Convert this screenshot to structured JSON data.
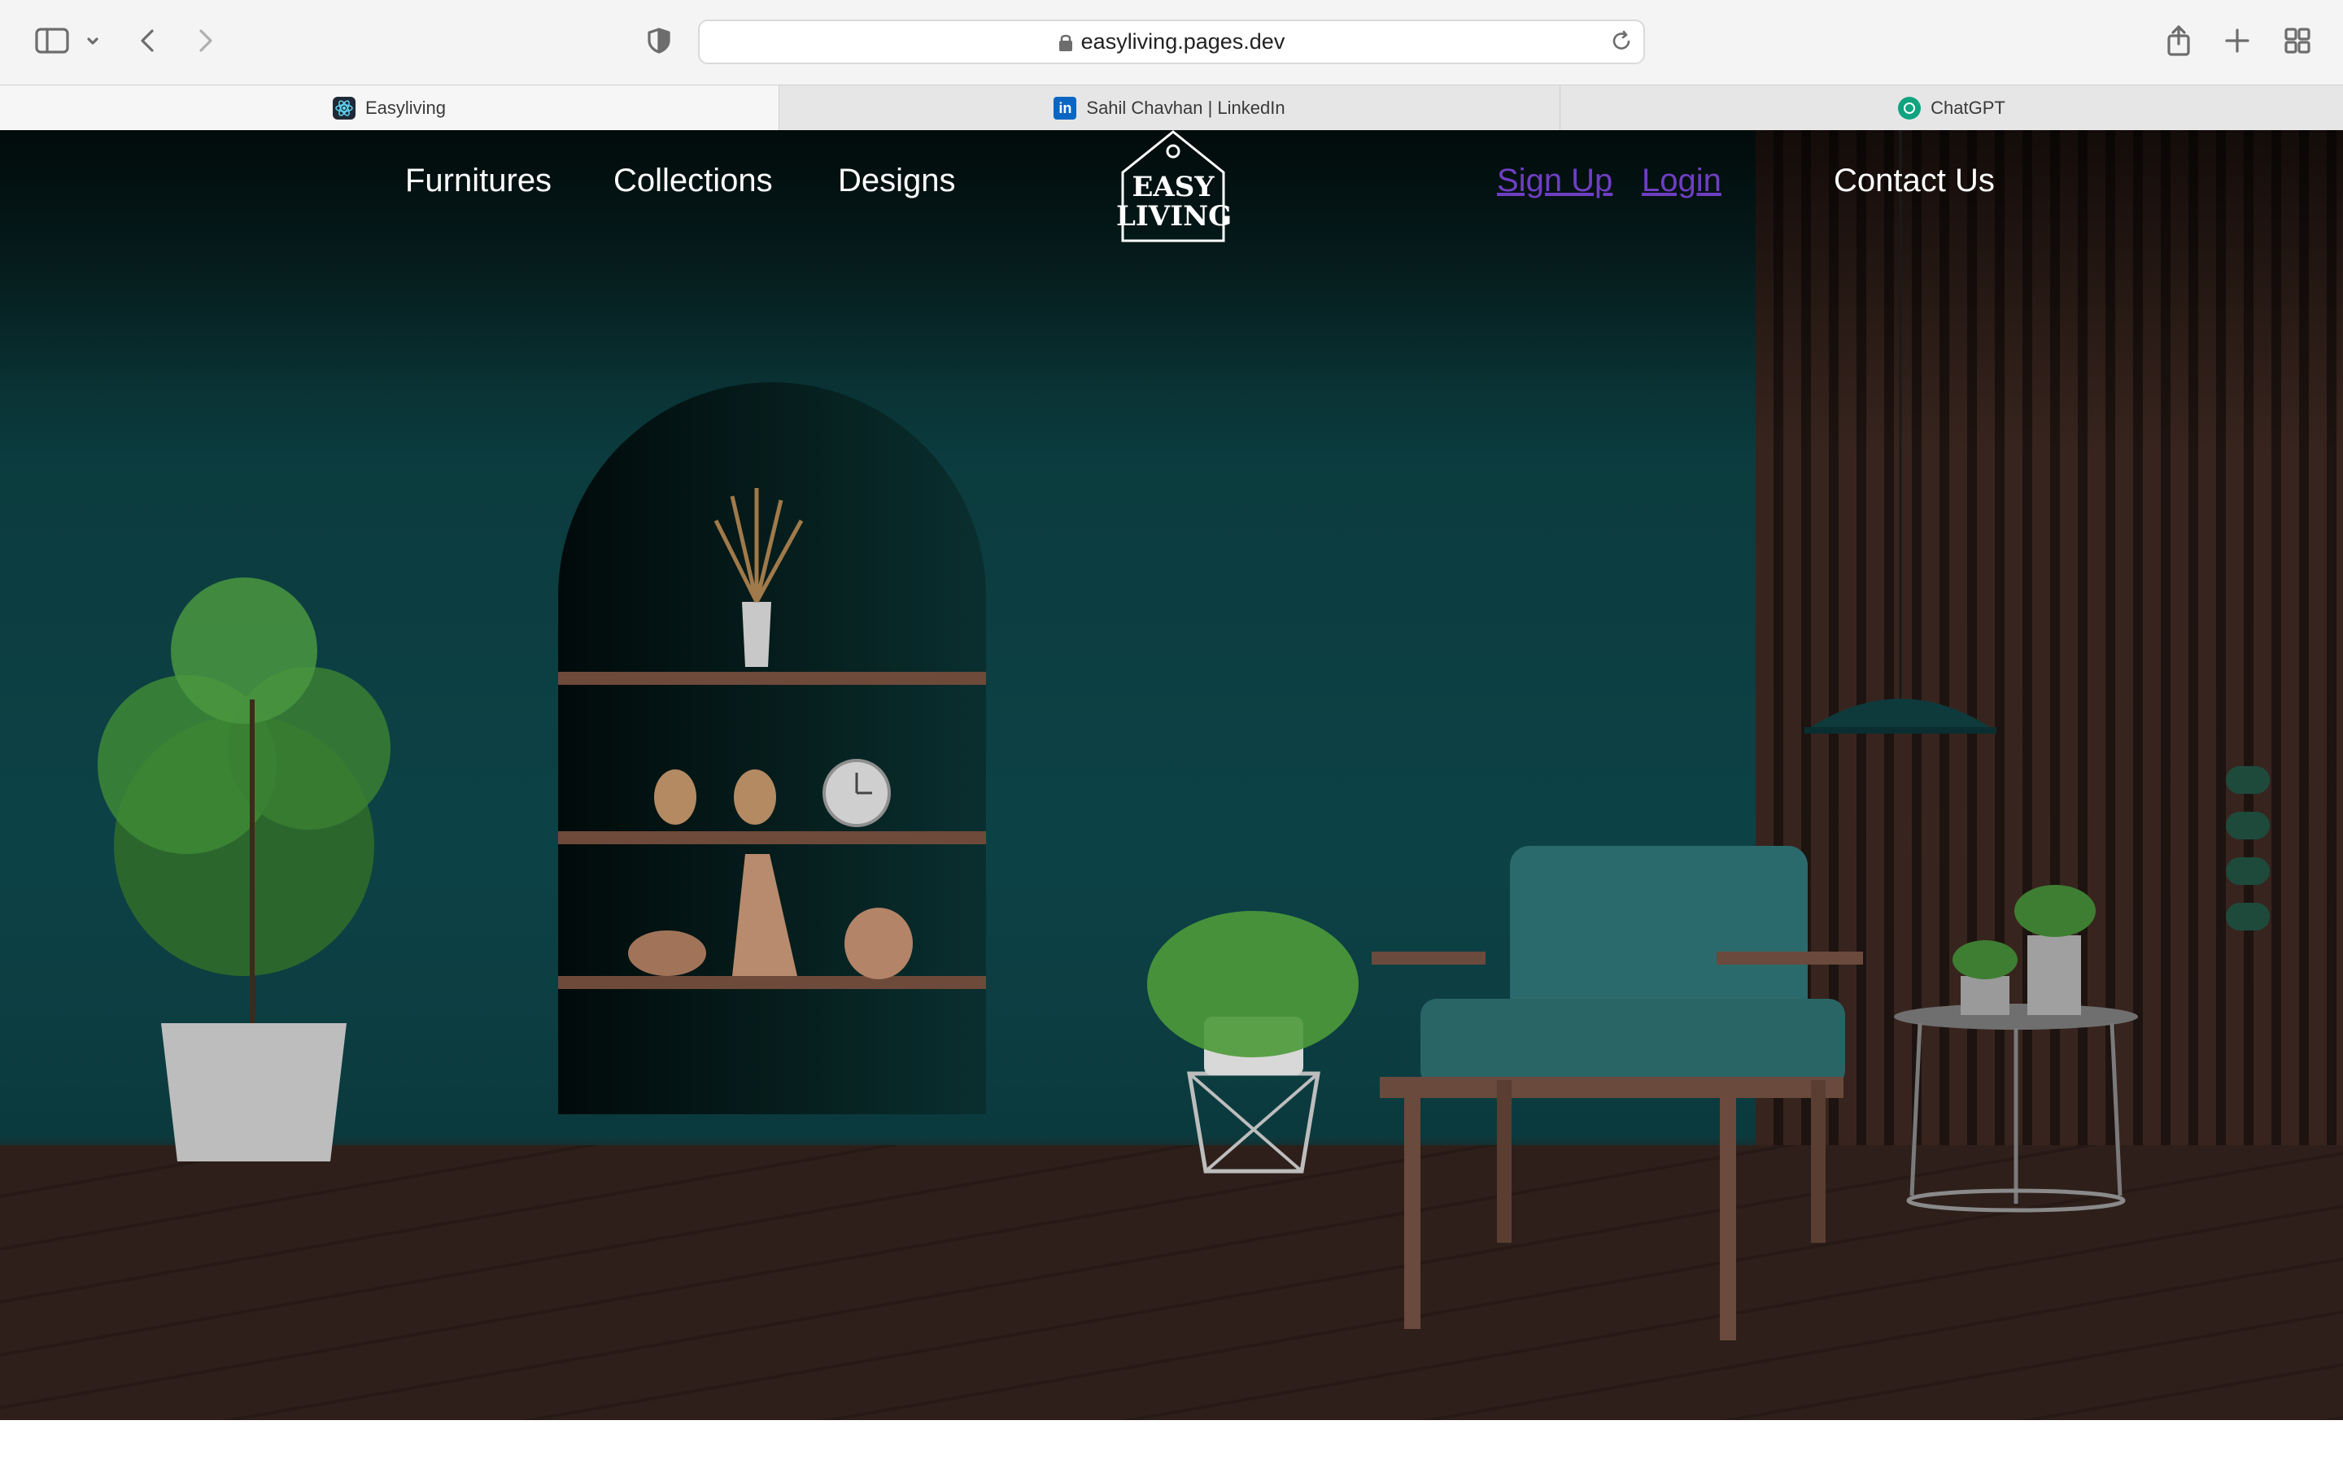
{
  "browser": {
    "url": "easyliving.pages.dev",
    "tabs": [
      {
        "label": "Easyliving",
        "icon": "react-icon",
        "active": true
      },
      {
        "label": "Sahil Chavhan | LinkedIn",
        "icon": "linkedin-icon",
        "active": false
      },
      {
        "label": "ChatGPT",
        "icon": "chatgpt-icon",
        "active": false
      }
    ]
  },
  "site": {
    "nav": {
      "furnitures": "Furnitures",
      "collections": "Collections",
      "designs": "Designs",
      "signup": "Sign Up",
      "login": "Login",
      "contact": "Contact Us"
    },
    "logo": {
      "line1": "EASY",
      "line2": "LIVING"
    },
    "slider": {
      "dots": 4
    }
  },
  "colors": {
    "wall": "#0c4246",
    "floor": "#2e1f1a",
    "auth_link": "#6f3ec2",
    "dot": "#1e4a3c"
  }
}
